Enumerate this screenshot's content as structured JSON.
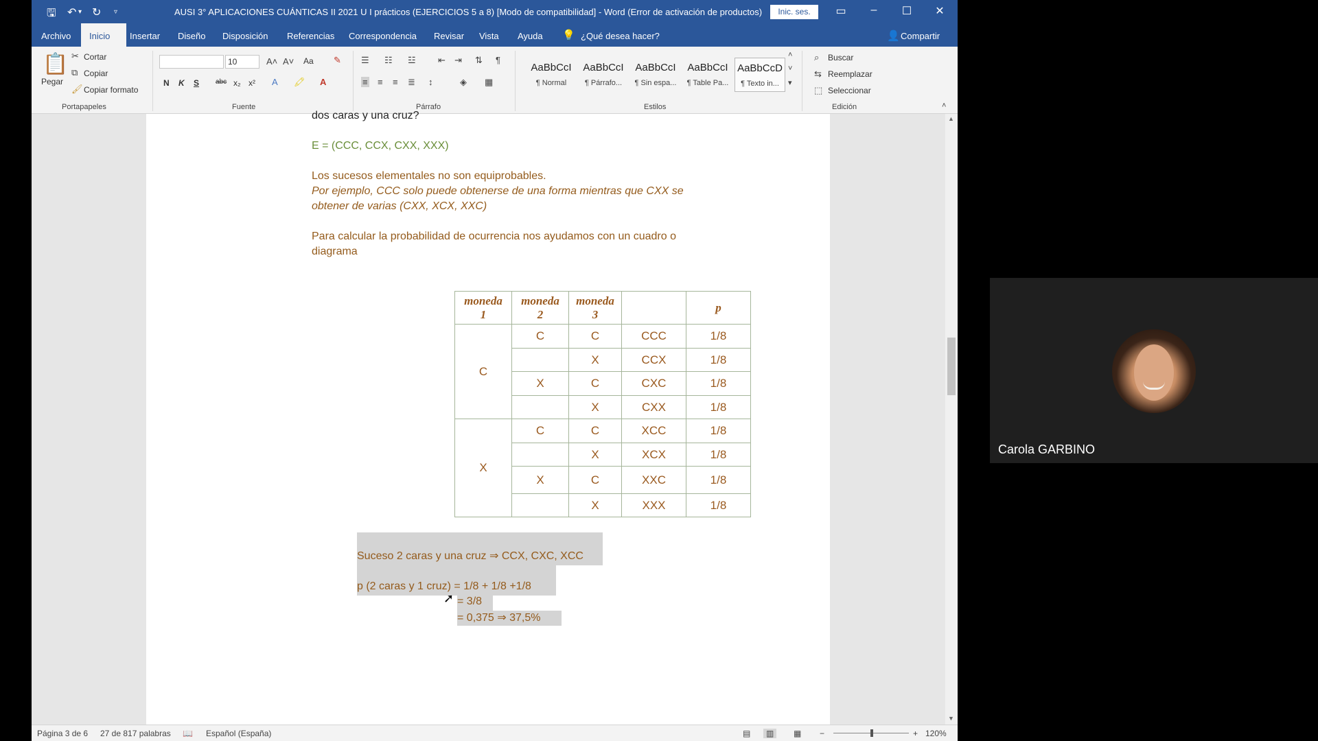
{
  "window": {
    "title": "AUSI 3° APLICACIONES CUÁNTICAS II 2021 U I prácticos (EJERCICIOS 5 a 8) [Modo de compatibilidad] - Word (Error de activación de productos)",
    "signin": "Inic. ses."
  },
  "tabs": [
    "Archivo",
    "Inicio",
    "Insertar",
    "Diseño",
    "Disposición",
    "Referencias",
    "Correspondencia",
    "Revisar",
    "Vista",
    "Ayuda"
  ],
  "tell_me": "¿Qué desea hacer?",
  "share": "Compartir",
  "ribbon": {
    "clipboard": {
      "paste": "Pegar",
      "cut": "Cortar",
      "copy": "Copiar",
      "format_painter": "Copiar formato",
      "label": "Portapapeles"
    },
    "font": {
      "name": "",
      "size": "10",
      "label": "Fuente",
      "case": "Aa",
      "bold": "N",
      "italic": "K",
      "underline": "S",
      "strike": "abc",
      "sub": "x₂",
      "sup": "x²"
    },
    "paragraph": {
      "label": "Párrafo"
    },
    "styles": {
      "label": "Estilos",
      "items": [
        {
          "sample": "AaBbCcI",
          "name": "¶ Normal"
        },
        {
          "sample": "AaBbCcI",
          "name": "¶ Párrafo..."
        },
        {
          "sample": "AaBbCcI",
          "name": "¶ Sin espa..."
        },
        {
          "sample": "AaBbCcI",
          "name": "¶ Table Pa..."
        },
        {
          "sample": "AaBbCcD",
          "name": "¶ Texto in..."
        }
      ]
    },
    "editing": {
      "find": "Buscar",
      "replace": "Reemplazar",
      "select": "Seleccionar",
      "label": "Edición"
    }
  },
  "document": {
    "line_question": "dos caras y una cruz?",
    "sample_space": "E = (CCC, CCX, CXX, XXX)",
    "not_equiprobable": "Los sucesos elementales no son equiprobables.",
    "example_1": "Por ejemplo, CCC solo puede obtenerse de una forma mientras que CXX se",
    "example_2": "obtener de varias (CXX, XCX, XXC)",
    "calc_1": "Para calcular la probabilidad de ocurrencia nos ayudamos con un cuadro o",
    "calc_2": "diagrama",
    "table": {
      "headers": [
        "moneda 1",
        "moneda 2",
        "moneda 3",
        "",
        "p"
      ],
      "coin1_groups": [
        "C",
        "X"
      ],
      "rows": [
        {
          "c2": "C",
          "c3": "C",
          "outcome": "CCC",
          "p": "1/8"
        },
        {
          "c2": "",
          "c3": "X",
          "outcome": "CCX",
          "p": "1/8"
        },
        {
          "c2": "X",
          "c3": "C",
          "outcome": "CXC",
          "p": "1/8"
        },
        {
          "c2": "",
          "c3": "X",
          "outcome": "CXX",
          "p": "1/8"
        },
        {
          "c2": "C",
          "c3": "C",
          "outcome": "XCC",
          "p": "1/8"
        },
        {
          "c2": "",
          "c3": "X",
          "outcome": "XCX",
          "p": "1/8"
        },
        {
          "c2": "X",
          "c3": "C",
          "outcome": "XXC",
          "p": "1/8"
        },
        {
          "c2": "",
          "c3": "X",
          "outcome": "XXX",
          "p": "1/8"
        }
      ]
    },
    "event": "Suceso 2 caras y una cruz  ⇒  CCX, CXC, XCC",
    "prob_line": "p (2 caras y 1 cruz) = 1/8 + 1/8 +1/8",
    "prob_eq1": "= 3/8",
    "prob_eq2": "= 0,375  ⇒   37,5%"
  },
  "status": {
    "page": "Página 3 de 6",
    "words": "27 de 817 palabras",
    "language": "Español (España)",
    "zoom": "120%"
  },
  "participant": {
    "name": "Carola GARBINO"
  },
  "colors": {
    "word_blue": "#2b579a",
    "text_green": "#6a8e3a",
    "text_brown": "#945b1c"
  }
}
